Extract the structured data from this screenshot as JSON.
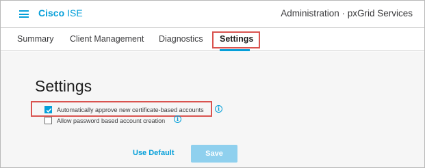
{
  "header": {
    "brand_name": "Cisco",
    "brand_product": "ISE",
    "page_context": "Administration · pxGrid Services"
  },
  "tabs": [
    {
      "label": "Summary",
      "active": false
    },
    {
      "label": "Client Management",
      "active": false
    },
    {
      "label": "Diagnostics",
      "active": false
    },
    {
      "label": "Settings",
      "active": true
    }
  ],
  "main": {
    "title": "Settings",
    "options": [
      {
        "label": "Automatically approve new certificate-based accounts",
        "checked": true,
        "info_icon": "info-icon"
      },
      {
        "label": "Allow password based account creation",
        "checked": false,
        "info_icon": "info-icon"
      }
    ],
    "use_default_label": "Use Default",
    "save_label": "Save"
  },
  "colors": {
    "accent": "#049fd9",
    "highlight": "#d9534f",
    "save_disabled": "#8fd0ee"
  }
}
